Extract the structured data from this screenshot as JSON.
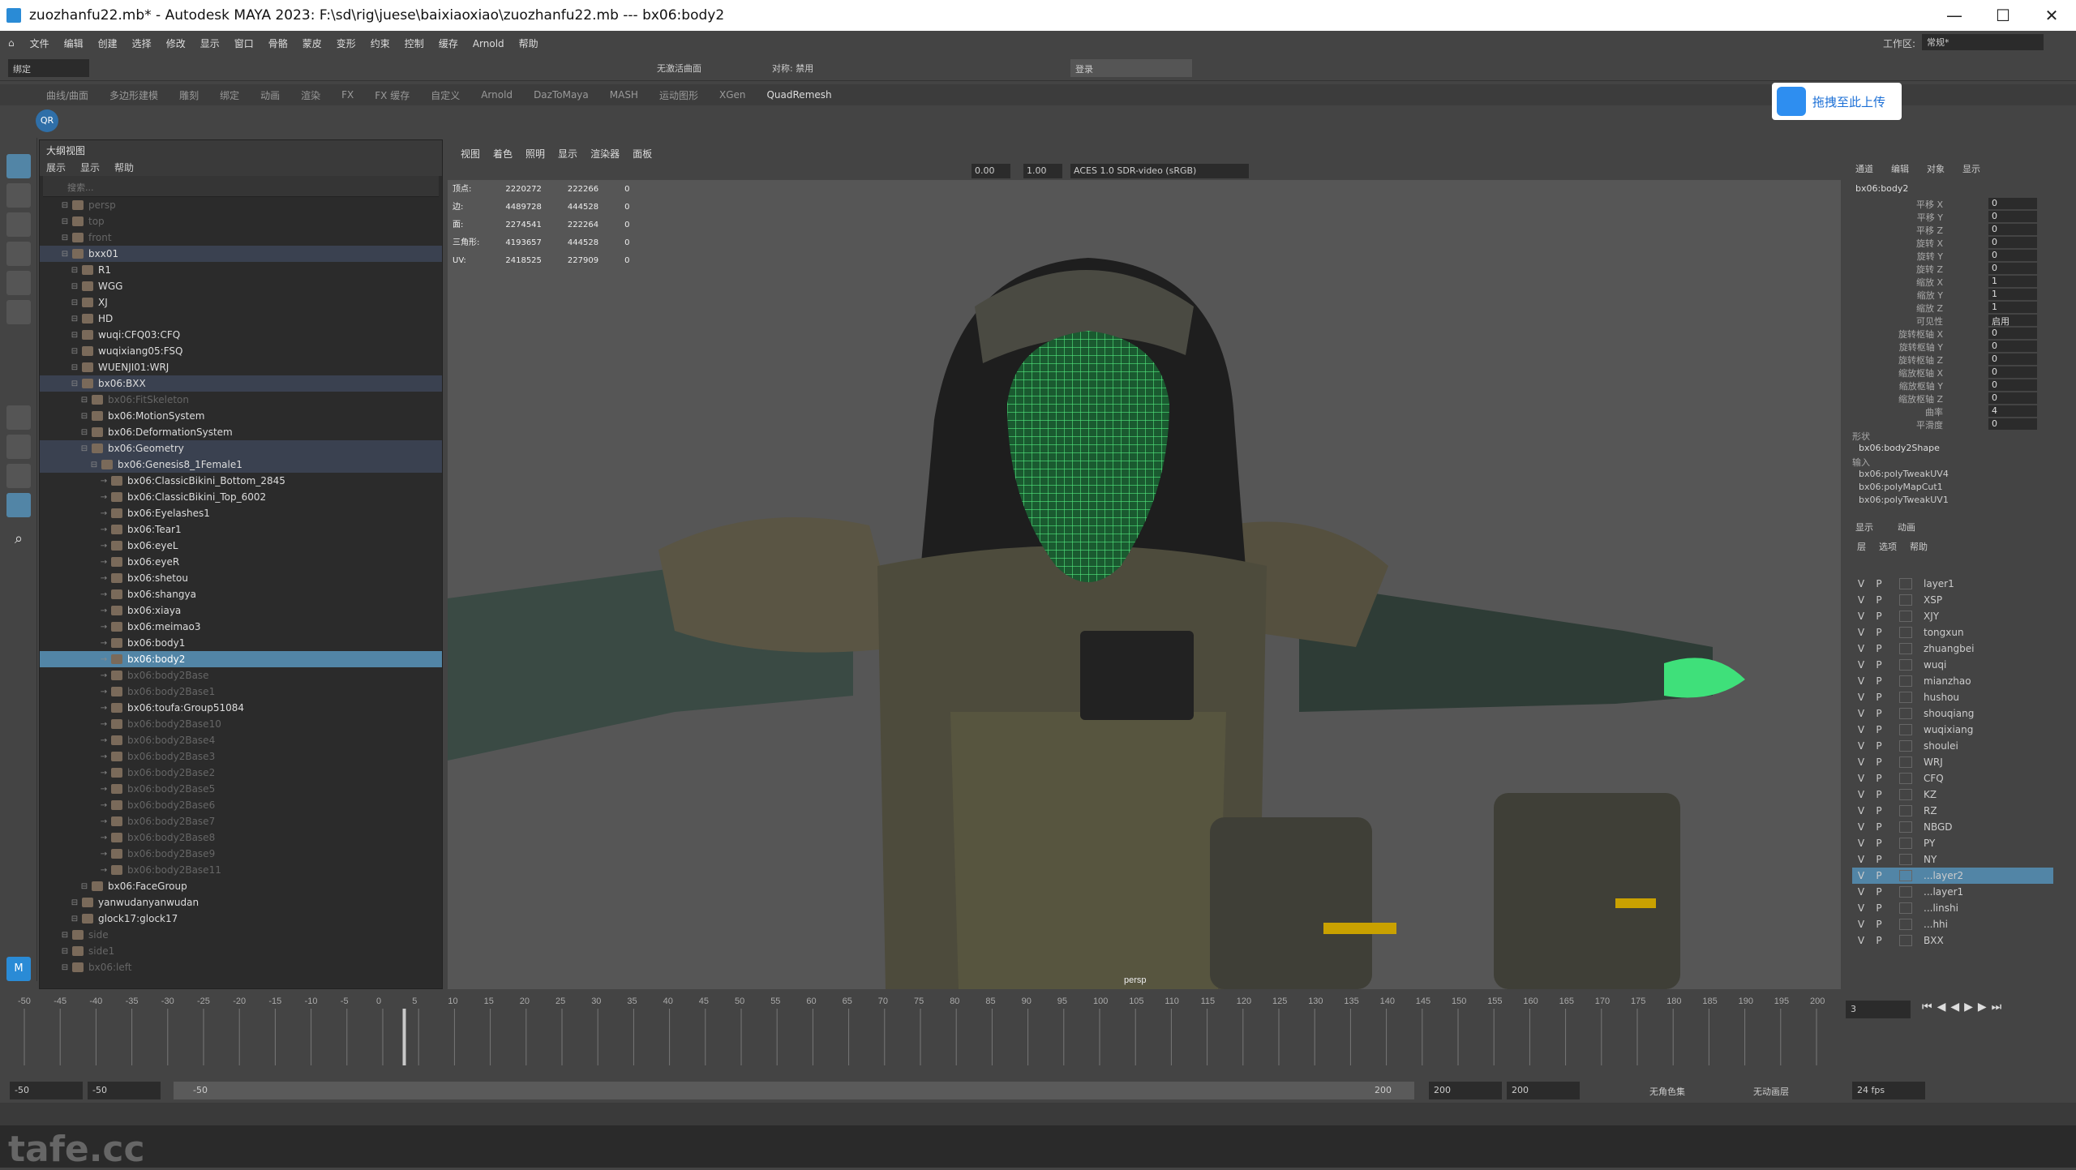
{
  "title": "zuozhanfu22.mb* - Autodesk MAYA 2023: F:\\sd\\rig\\juese\\baixiaoxiao\\zuozhanfu22.mb   ---   bx06:body2",
  "menus": [
    "文件",
    "编辑",
    "创建",
    "选择",
    "修改",
    "显示",
    "窗口",
    "骨骼",
    "蒙皮",
    "变形",
    "约束",
    "控制",
    "缓存",
    "Arnold",
    "帮助"
  ],
  "workspace_label": "工作区:",
  "workspace_value": "常规*",
  "status": {
    "mode": "绑定",
    "no_live": "无激活曲面",
    "symmetry": "对称: 禁用",
    "login": "登录"
  },
  "shelf_tabs": [
    "曲线/曲面",
    "多边形建模",
    "雕刻",
    "绑定",
    "动画",
    "渲染",
    "FX",
    "FX 缓存",
    "自定义",
    "Arnold",
    "DazToMaya",
    "MASH",
    "运动图形",
    "XGen",
    "QuadRemesh"
  ],
  "upload_btn": "拖拽至此上传",
  "outliner": {
    "title": "大纲视图",
    "menus": [
      "展示",
      "显示",
      "帮助"
    ],
    "search": "搜索...",
    "rows": [
      {
        "t": "persp",
        "d": 0,
        "c": "dim"
      },
      {
        "t": "top",
        "d": 0,
        "c": "dim"
      },
      {
        "t": "front",
        "d": 0,
        "c": "dim"
      },
      {
        "t": "bxx01",
        "d": 0,
        "c": "grp"
      },
      {
        "t": "R1",
        "d": 1
      },
      {
        "t": "WGG",
        "d": 1
      },
      {
        "t": "XJ",
        "d": 1
      },
      {
        "t": "HD",
        "d": 1
      },
      {
        "t": "wuqi:CFQ03:CFQ",
        "d": 1
      },
      {
        "t": "wuqixiang05:FSQ",
        "d": 1
      },
      {
        "t": "WUENJI01:WRJ",
        "d": 1
      },
      {
        "t": "bx06:BXX",
        "d": 1,
        "c": "grp"
      },
      {
        "t": "bx06:FitSkeleton",
        "d": 2,
        "c": "dim"
      },
      {
        "t": "bx06:MotionSystem",
        "d": 2
      },
      {
        "t": "bx06:DeformationSystem",
        "d": 2
      },
      {
        "t": "bx06:Geometry",
        "d": 2,
        "c": "grp"
      },
      {
        "t": "bx06:Genesis8_1Female1",
        "d": 3,
        "c": "grp"
      },
      {
        "t": "bx06:ClassicBikini_Bottom_2845",
        "d": 4
      },
      {
        "t": "bx06:ClassicBikini_Top_6002",
        "d": 4
      },
      {
        "t": "bx06:Eyelashes1",
        "d": 4
      },
      {
        "t": "bx06:Tear1",
        "d": 4
      },
      {
        "t": "bx06:eyeL",
        "d": 4
      },
      {
        "t": "bx06:eyeR",
        "d": 4
      },
      {
        "t": "bx06:shetou",
        "d": 4
      },
      {
        "t": "bx06:shangya",
        "d": 4
      },
      {
        "t": "bx06:xiaya",
        "d": 4
      },
      {
        "t": "bx06:meimao3",
        "d": 4
      },
      {
        "t": "bx06:body1",
        "d": 4
      },
      {
        "t": "bx06:body2",
        "d": 4,
        "c": "sel"
      },
      {
        "t": "bx06:body2Base",
        "d": 4,
        "c": "dim"
      },
      {
        "t": "bx06:body2Base1",
        "d": 4,
        "c": "dim"
      },
      {
        "t": "bx06:toufa:Group51084",
        "d": 4
      },
      {
        "t": "bx06:body2Base10",
        "d": 4,
        "c": "dim"
      },
      {
        "t": "bx06:body2Base4",
        "d": 4,
        "c": "dim"
      },
      {
        "t": "bx06:body2Base3",
        "d": 4,
        "c": "dim"
      },
      {
        "t": "bx06:body2Base2",
        "d": 4,
        "c": "dim"
      },
      {
        "t": "bx06:body2Base5",
        "d": 4,
        "c": "dim"
      },
      {
        "t": "bx06:body2Base6",
        "d": 4,
        "c": "dim"
      },
      {
        "t": "bx06:body2Base7",
        "d": 4,
        "c": "dim"
      },
      {
        "t": "bx06:body2Base8",
        "d": 4,
        "c": "dim"
      },
      {
        "t": "bx06:body2Base9",
        "d": 4,
        "c": "dim"
      },
      {
        "t": "bx06:body2Base11",
        "d": 4,
        "c": "dim"
      },
      {
        "t": "bx06:FaceGroup",
        "d": 2
      },
      {
        "t": "yanwudanyanwudan",
        "d": 1
      },
      {
        "t": "glock17:glock17",
        "d": 1
      },
      {
        "t": "side",
        "d": 0,
        "c": "dim"
      },
      {
        "t": "side1",
        "d": 0,
        "c": "dim"
      },
      {
        "t": "bx06:left",
        "d": 0,
        "c": "dim"
      }
    ]
  },
  "viewport": {
    "menus": [
      "视图",
      "着色",
      "照明",
      "显示",
      "渲染器",
      "面板"
    ],
    "exposure": "0.00",
    "gamma": "1.00",
    "colorspace": "ACES 1.0 SDR-video (sRGB)",
    "camera": "persp",
    "hud": [
      [
        "顶点:",
        "2220272",
        "222266",
        "0"
      ],
      [
        "边:",
        "4489728",
        "444528",
        "0"
      ],
      [
        "面:",
        "2274541",
        "222264",
        "0"
      ],
      [
        "三角形:",
        "4193657",
        "444528",
        "0"
      ],
      [
        "UV:",
        "2418525",
        "227909",
        "0"
      ]
    ]
  },
  "channel": {
    "tabs": [
      "通道",
      "编辑",
      "对象",
      "显示"
    ],
    "node": "bx06:body2",
    "attrs": [
      [
        "平移 X",
        "0"
      ],
      [
        "平移 Y",
        "0"
      ],
      [
        "平移 Z",
        "0"
      ],
      [
        "旋转 X",
        "0"
      ],
      [
        "旋转 Y",
        "0"
      ],
      [
        "旋转 Z",
        "0"
      ],
      [
        "缩放 X",
        "1"
      ],
      [
        "缩放 Y",
        "1"
      ],
      [
        "缩放 Z",
        "1"
      ],
      [
        "可见性",
        "启用"
      ],
      [
        "旋转枢轴 X",
        "0"
      ],
      [
        "旋转枢轴 Y",
        "0"
      ],
      [
        "旋转枢轴 Z",
        "0"
      ],
      [
        "缩放枢轴 X",
        "0"
      ],
      [
        "缩放枢轴 Y",
        "0"
      ],
      [
        "缩放枢轴 Z",
        "0"
      ],
      [
        "曲率",
        "4"
      ],
      [
        "平滑度",
        "0"
      ]
    ],
    "shape_label": "形状",
    "shape": "bx06:body2Shape",
    "input_label": "输入",
    "inputs": [
      "bx06:polyTweakUV4",
      "bx06:polyMapCut1",
      "bx06:polyTweakUV1"
    ]
  },
  "layers": {
    "tabs": [
      "显示",
      "动画"
    ],
    "menus": [
      "层",
      "选项",
      "帮助"
    ],
    "items": [
      "layer1",
      "XSP",
      "XJY",
      "tongxun",
      "zhuangbei",
      "wuqi",
      "mianzhao",
      "hushou",
      "shouqiang",
      "wuqixiang",
      "shoulei",
      "WRJ",
      "CFQ",
      "KZ",
      "RZ",
      "NBGD",
      "PY",
      "NY",
      "...layer2",
      "...layer1",
      "...linshi",
      "...hhi",
      "BXX"
    ],
    "selected": "...layer2"
  },
  "timeline": {
    "ticks": [
      "-50",
      "-45",
      "-40",
      "-35",
      "-30",
      "-25",
      "-20",
      "-15",
      "-10",
      "-5",
      "0",
      "5",
      "10",
      "15",
      "20",
      "25",
      "30",
      "35",
      "40",
      "45",
      "50",
      "55",
      "60",
      "65",
      "70",
      "75",
      "80",
      "85",
      "90",
      "95",
      "100",
      "105",
      "110",
      "115",
      "120",
      "125",
      "130",
      "135",
      "140",
      "145",
      "150",
      "155",
      "160",
      "165",
      "170",
      "175",
      "180",
      "185",
      "190",
      "195",
      "200"
    ],
    "current": "3"
  },
  "range": {
    "start": "-50",
    "start2": "-50",
    "slider_start": "-50",
    "slider_end": "200",
    "end": "200",
    "end2": "200",
    "charset": "无角色集",
    "anim_layer": "无动画层",
    "fps": "24 fps"
  },
  "watermark": "tafe.cc"
}
